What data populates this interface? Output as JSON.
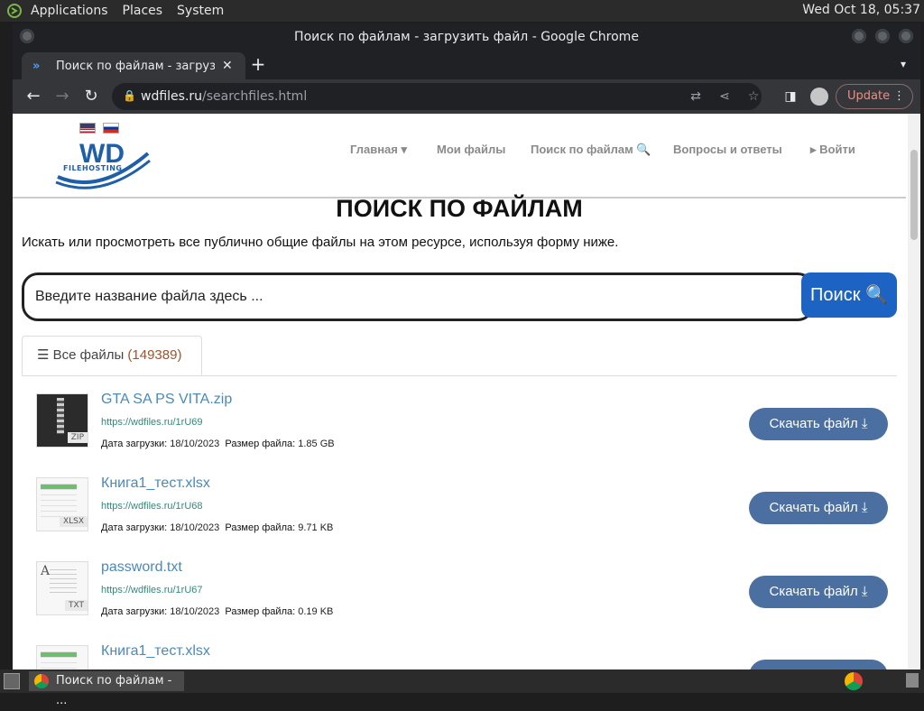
{
  "desktop": {
    "menus": [
      "Applications",
      "Places",
      "System"
    ],
    "clock": "Wed Oct 18, 05:37"
  },
  "window": {
    "title": "Поиск по файлам - загрузить файл - Google Chrome"
  },
  "browser": {
    "tab_title": "Поиск по файлам - загрузить файл",
    "url_domain": "wdfiles.ru",
    "url_path": "/searchfiles.html",
    "update_label": "Update"
  },
  "site": {
    "logo_text": "WD",
    "logo_sub": "FILEHOSTING",
    "nav": [
      {
        "label": "Главная ▾"
      },
      {
        "label": "Мои файлы"
      },
      {
        "label": "Поиск по файлам 🔍"
      },
      {
        "label": "Вопросы и ответы"
      },
      {
        "label": "▸ Войти"
      }
    ]
  },
  "content": {
    "title": "ПОИСК ПО ФАЙЛАМ",
    "description": "Искать или просмотреть все публично общие файлы на этом ресурсе, используя форму ниже.",
    "search_placeholder": "Введите название файла здесь ...",
    "search_button": "Поиск 🔍",
    "tab_label": "☰ Все файлы",
    "tab_count": "(149389)"
  },
  "files": [
    {
      "name": "GTA SA PS VITA.zip",
      "link": "https://wdfiles.ru/1rU69",
      "date_label": "Дата загрузки:",
      "date": "18/10/2023",
      "size_label": "Размер файла:",
      "size": "1.85 GB",
      "ext": "ZIP"
    },
    {
      "name": "Книга1_тест.xlsx",
      "link": "https://wdfiles.ru/1rU68",
      "date_label": "Дата загрузки:",
      "date": "18/10/2023",
      "size_label": "Размер файла:",
      "size": "9.71 KB",
      "ext": "XLSX"
    },
    {
      "name": "password.txt",
      "link": "https://wdfiles.ru/1rU67",
      "date_label": "Дата загрузки:",
      "date": "18/10/2023",
      "size_label": "Размер файла:",
      "size": "0.19 KB",
      "ext": "TXT"
    },
    {
      "name": "Книга1_тест.xlsx",
      "link": "",
      "date_label": "",
      "date": "",
      "size_label": "",
      "size": "",
      "ext": ""
    }
  ],
  "download_label": "Скачать файл ⤓",
  "taskbar": {
    "task_label": "Поиск по файлам - ..."
  }
}
